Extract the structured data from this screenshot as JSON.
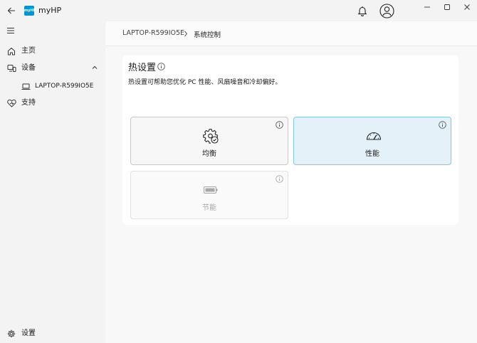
{
  "window": {
    "app_title": "myHP",
    "logo_text": "myHP"
  },
  "sidebar": {
    "items": [
      {
        "label": "主页",
        "icon": "home-icon"
      },
      {
        "label": "设备",
        "icon": "devices-icon"
      },
      {
        "label": "LAPTOP-R599IO5E",
        "icon": "laptop-icon"
      },
      {
        "label": "支持",
        "icon": "support-icon"
      }
    ],
    "settings_label": "设置"
  },
  "breadcrumb": {
    "device": "LAPTOP-R599IO5E",
    "current": "系统控制"
  },
  "thermal": {
    "title": "热设置",
    "description": "热设置可帮助您优化 PC 性能、风扇噪音和冷却偏好。",
    "modes": [
      {
        "label": "均衡",
        "icon": "gear-check-icon",
        "state": "available"
      },
      {
        "label": "性能",
        "icon": "speedometer-icon",
        "state": "selected"
      },
      {
        "label": "节能",
        "icon": "battery-icon",
        "state": "disabled"
      }
    ]
  },
  "colors": {
    "selected_bg": "#e5f1f9",
    "selected_border": "#80c8e8",
    "brand": "#0096d6"
  }
}
